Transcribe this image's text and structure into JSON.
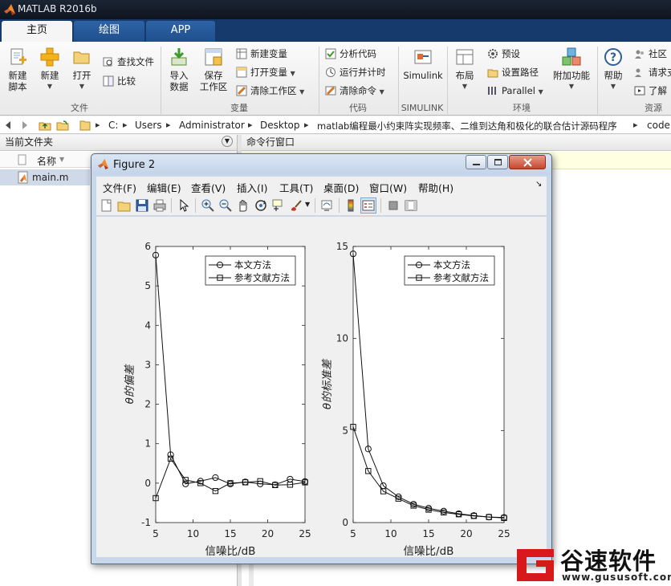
{
  "app": {
    "title": "MATLAB R2016b"
  },
  "tabs": [
    {
      "label": "主页"
    },
    {
      "label": "绘图"
    },
    {
      "label": "APP"
    }
  ],
  "ribbon": {
    "new_script": "新建\n脚本",
    "new_script_l1": "新建",
    "new_script_l2": "脚本",
    "new": "新建",
    "open": "打开",
    "find_files": "查找文件",
    "compare": "比较",
    "import_l1": "导入",
    "import_l2": "数据",
    "save_ws_l1": "保存",
    "save_ws_l2": "工作区",
    "new_var": "新建变量",
    "open_var": "打开变量",
    "clear_ws": "清除工作区",
    "analyze_code": "分析代码",
    "run_time": "运行并计时",
    "clear_cmd": "清除命令",
    "simulink": "Simulink",
    "layout": "布局",
    "prefs": "预设",
    "set_path": "设置路径",
    "parallel": "Parallel",
    "addons": "附加功能",
    "help": "帮助",
    "community": "社区",
    "request": "请求支",
    "learn": "了解",
    "groups": {
      "file": "文件",
      "variable": "变量",
      "code": "代码",
      "simulink": "SIMULINK",
      "env": "环境",
      "resources": "资源"
    }
  },
  "address": {
    "crumbs": [
      "C:",
      "Users",
      "Administrator",
      "Desktop",
      "matlab编程最小约束阵实现频率、二维到达角和极化的联合估计源码程序",
      "code"
    ]
  },
  "left_panel": {
    "title": "当前文件夹",
    "col_name": "名称",
    "col_sort": "▼",
    "files": [
      {
        "name": "main.m"
      }
    ]
  },
  "command_window": {
    "title": "命令行窗口"
  },
  "figure": {
    "title": "Figure 2",
    "menu": [
      "文件(F)",
      "编辑(E)",
      "查看(V)",
      "插入(I)",
      "工具(T)",
      "桌面(D)",
      "窗口(W)",
      "帮助(H)"
    ]
  },
  "chart_data": [
    {
      "type": "line",
      "x": [
        5,
        7,
        9,
        11,
        13,
        15,
        17,
        19,
        21,
        23,
        25
      ],
      "xlabel": "信噪比/dB",
      "ylabel": "θ的偏差",
      "xlim": [
        5,
        25
      ],
      "ylim": [
        -1,
        6
      ],
      "xticks": [
        "5",
        "10",
        "15",
        "20",
        "25"
      ],
      "yticks": [
        "-1",
        "0",
        "1",
        "2",
        "3",
        "4",
        "5",
        "6"
      ],
      "grid": false,
      "legend": "top-right",
      "series": [
        {
          "name": "本文方法",
          "marker": "circle",
          "values": [
            5.78,
            0.72,
            -0.02,
            0.05,
            0.14,
            -0.02,
            0.03,
            -0.02,
            -0.04,
            0.1,
            0.04
          ]
        },
        {
          "name": "参考文献方法",
          "marker": "square",
          "values": [
            -0.38,
            0.62,
            0.08,
            0.0,
            -0.2,
            0.0,
            0.02,
            0.05,
            -0.05,
            -0.04,
            0.02
          ]
        }
      ]
    },
    {
      "type": "line",
      "x": [
        5,
        7,
        9,
        11,
        13,
        15,
        17,
        19,
        21,
        23,
        25
      ],
      "xlabel": "信噪比/dB",
      "ylabel": "θ的标准差",
      "xlim": [
        5,
        25
      ],
      "ylim": [
        0,
        15
      ],
      "xticks": [
        "5",
        "10",
        "15",
        "20",
        "25"
      ],
      "yticks": [
        "0",
        "5",
        "10",
        "15"
      ],
      "grid": false,
      "legend": "top-right",
      "series": [
        {
          "name": "本文方法",
          "marker": "circle",
          "values": [
            14.6,
            4.0,
            2.0,
            1.4,
            1.0,
            0.78,
            0.62,
            0.48,
            0.38,
            0.3,
            0.28
          ]
        },
        {
          "name": "参考文献方法",
          "marker": "square",
          "values": [
            5.2,
            2.8,
            1.7,
            1.3,
            0.92,
            0.7,
            0.55,
            0.45,
            0.36,
            0.3,
            0.25
          ]
        }
      ]
    }
  ],
  "watermark": {
    "brand": "谷速软件",
    "url": "www.gususoft.com"
  }
}
